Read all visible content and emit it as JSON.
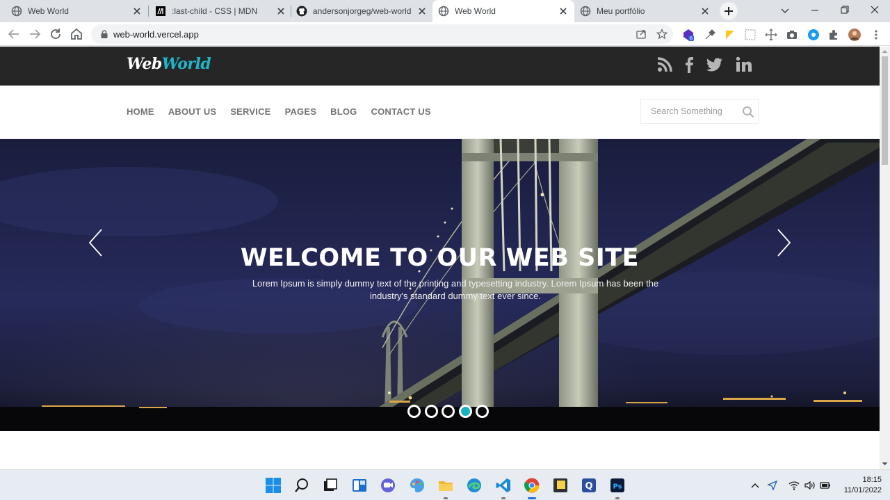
{
  "browser": {
    "tabs": [
      {
        "title": "Web World",
        "active": false
      },
      {
        "title": ":last-child - CSS | MDN",
        "active": false
      },
      {
        "title": "andersonjorgeg/web-world",
        "active": false
      },
      {
        "title": "Web World",
        "active": true
      },
      {
        "title": "Meu portfólio",
        "active": false
      }
    ],
    "url": "web-world.vercel.app",
    "extension_badge": "6"
  },
  "site": {
    "logo": {
      "part1": "Web",
      "part2": "World"
    },
    "social": [
      "rss-icon",
      "facebook-icon",
      "twitter-icon",
      "linkedin-icon"
    ],
    "menu": [
      "HOME",
      "ABOUT US",
      "SERVICE",
      "PAGES",
      "BLOG",
      "CONTACT US"
    ],
    "search_placeholder": "Search Something",
    "hero": {
      "title": "WELCOME TO OUR WEB SITE",
      "text": "Lorem Ipsum is simply dummy text of the printing and typesetting industry. Lorem Ipsum has been the industry's standard dummy text ever since.",
      "slides": 5,
      "active_slide": 4
    }
  },
  "taskbar": {
    "time": "18:15",
    "date": "11/01/2022"
  },
  "colors": {
    "accent": "#1fb5c9",
    "topbar": "#262626",
    "menu_text": "#737373"
  }
}
